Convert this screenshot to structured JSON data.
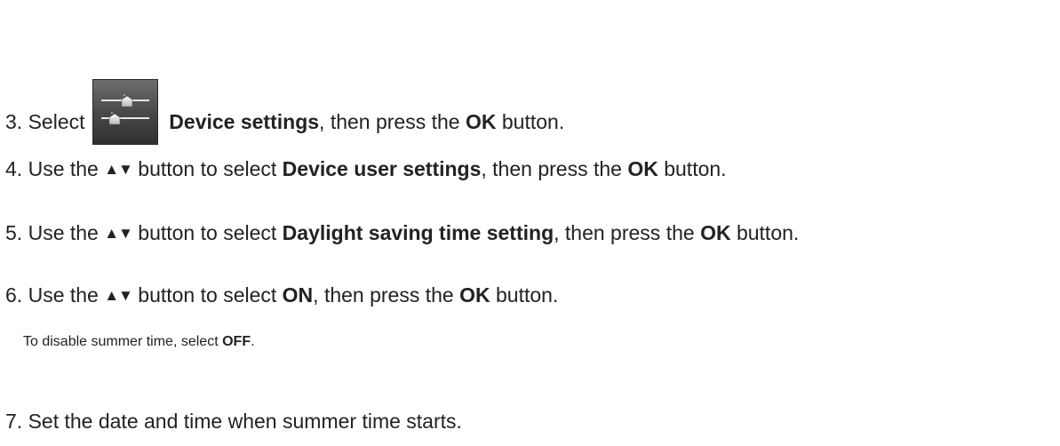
{
  "steps": [
    {
      "num": "3.",
      "pre": "Select",
      "icon": "device-settings-icon",
      "bold1": "Device settings",
      "mid": ", then press the",
      "bold2": "OK",
      "post": "button."
    },
    {
      "num": "4.",
      "pre": "Use the",
      "arrows": "▲▼",
      "mid1": "button to select",
      "bold1": "Device user settings",
      "mid2": ", then press the",
      "bold2": "OK",
      "post": "button."
    },
    {
      "num": "5.",
      "pre": "Use the",
      "arrows": "▲▼",
      "mid1": "button to select",
      "bold1": "Daylight saving time setting",
      "mid2": ", then press the",
      "bold2": "OK",
      "post": "button."
    },
    {
      "num": "6.",
      "pre": "Use the",
      "arrows": "▲▼",
      "mid1": "button to select",
      "bold1": "ON",
      "mid2": ", then press the",
      "bold2": "OK",
      "post": "button."
    },
    {
      "num": "7.",
      "text": "Set the date and time when summer time starts."
    }
  ],
  "note": {
    "pre": "To disable summer time, select",
    "bold": "OFF",
    "post": "."
  }
}
